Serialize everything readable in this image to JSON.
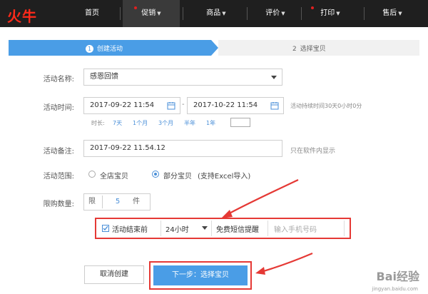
{
  "brand": {
    "logo_text": "火牛"
  },
  "nav": {
    "items": [
      {
        "label": "首页",
        "has_dot": false,
        "has_caret": false,
        "active": false
      },
      {
        "label": "促销",
        "has_dot": true,
        "has_caret": true,
        "active": true
      },
      {
        "label": "商品",
        "has_dot": false,
        "has_caret": true,
        "active": false
      },
      {
        "label": "评价",
        "has_dot": false,
        "has_caret": true,
        "active": false
      },
      {
        "label": "打印",
        "has_dot": true,
        "has_caret": true,
        "active": false
      },
      {
        "label": "售后",
        "has_dot": false,
        "has_caret": true,
        "active": false
      }
    ]
  },
  "steps": [
    {
      "num": "1",
      "label": "创建活动"
    },
    {
      "num": "2",
      "label": "选择宝贝"
    }
  ],
  "form": {
    "name_label": "活动名称:",
    "name_value": "感恩回馈",
    "time_label": "活动时间:",
    "start_time": "2017-09-22 11:54",
    "end_time": "2017-10-22 11:54",
    "time_sep": "-",
    "time_hint": "活动持续时间30天0小时0分",
    "duration_label": "时长:",
    "duration_options": [
      "7天",
      "1个月",
      "3个月",
      "半年",
      "1年"
    ],
    "note_label": "活动备注:",
    "note_value": "2017-09-22 11.54.12",
    "note_hint": "只在软件内显示",
    "scope_label": "活动范围:",
    "scope_all": "全店宝贝",
    "scope_part": "部分宝贝",
    "scope_part_hint": "(支持Excel导入)",
    "limit_label": "限购数量:",
    "limit_prefix": "限",
    "limit_value": "5",
    "limit_suffix": "件",
    "end_reminder_label": "活动结束前",
    "end_reminder_value": "24小时",
    "sms_label": "免费短信提醒",
    "phone_placeholder": "输入手机号码"
  },
  "buttons": {
    "cancel": "取消创建",
    "next": "下一步：选择宝贝"
  },
  "watermark": {
    "brand": "Bai经验",
    "url": "jingyan.baidu.com"
  },
  "colors": {
    "accent": "#4a9de6",
    "nav_bg": "#1f1f1f",
    "highlight": "#e53935",
    "logo": "#ff2a1a"
  }
}
